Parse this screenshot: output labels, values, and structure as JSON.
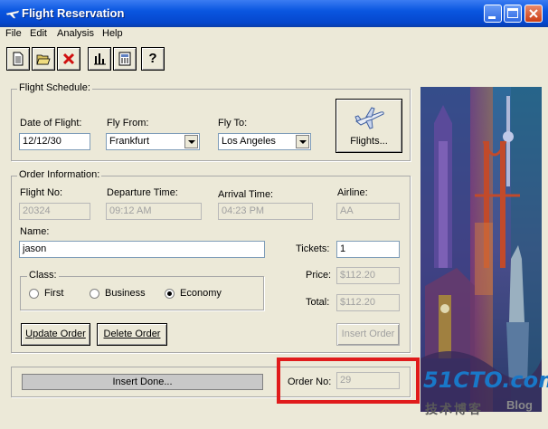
{
  "window": {
    "title": "Flight Reservation"
  },
  "menu": [
    "File",
    "Edit",
    "Analysis",
    "Help"
  ],
  "toolbar": {
    "icons": [
      "new-document-icon",
      "open-folder-icon",
      "delete-icon",
      "graph-icon",
      "calculator-icon",
      "help-icon"
    ],
    "help_glyph": "?"
  },
  "schedule": {
    "group_label": "Flight Schedule:",
    "date_label": "Date of Flight:",
    "date_value": "12/12/30",
    "from_label": "Fly From:",
    "from_value": "Frankfurt",
    "to_label": "Fly To:",
    "to_value": "Los Angeles",
    "flights_button": "Flights..."
  },
  "order": {
    "group_label": "Order Information:",
    "flight_no_label": "Flight No:",
    "flight_no_value": "20324",
    "departure_label": "Departure Time:",
    "departure_value": "09:12 AM",
    "arrival_label": "Arrival Time:",
    "arrival_value": "04:23 PM",
    "airline_label": "Airline:",
    "airline_value": "AA",
    "name_label": "Name:",
    "name_value": "jason",
    "tickets_label": "Tickets:",
    "tickets_value": "1",
    "class_label": "Class:",
    "class_options": [
      "First",
      "Business",
      "Economy"
    ],
    "class_selected": "Economy",
    "price_label": "Price:",
    "price_value": "$112.20",
    "total_label": "Total:",
    "total_value": "$112.20",
    "update_button": "Update Order",
    "delete_button": "Delete Order",
    "insert_button": "Insert Order"
  },
  "status": {
    "message": "Insert Done...",
    "order_no_label": "Order No:",
    "order_no_value": "29"
  },
  "watermark": {
    "site": "51CTO.com",
    "subtitle": "技术博客",
    "blog": "Blog"
  },
  "colors": {
    "titlebar": "#0a56e0",
    "highlight_box": "#e01b1b"
  }
}
